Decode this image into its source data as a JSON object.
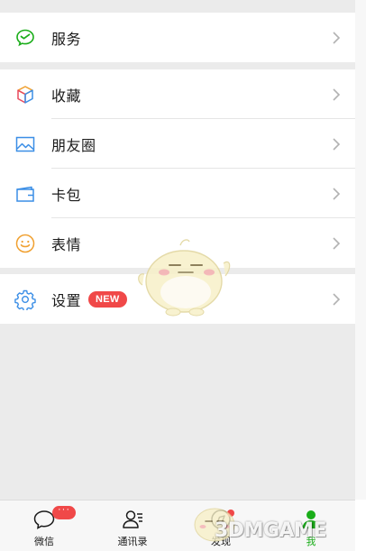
{
  "menu": {
    "services": {
      "label": "服务",
      "icon": "wechat-pay-icon"
    },
    "favorites": {
      "label": "收藏",
      "icon": "cube-icon"
    },
    "moments": {
      "label": "朋友圈",
      "icon": "photo-icon"
    },
    "cards": {
      "label": "卡包",
      "icon": "card-wallet-icon"
    },
    "stickers": {
      "label": "表情",
      "icon": "smiley-icon"
    },
    "settings": {
      "label": "设置",
      "icon": "gear-icon",
      "badge": "NEW"
    }
  },
  "tabbar": {
    "tabs": [
      {
        "label": "微信",
        "icon": "chat-bubble-icon",
        "badge": "···"
      },
      {
        "label": "通讯录",
        "icon": "contacts-icon"
      },
      {
        "label": "发现",
        "icon": "compass-icon"
      },
      {
        "label": "我",
        "icon": "person-icon",
        "active": true
      }
    ]
  },
  "watermark": {
    "text": "3DMGAME"
  },
  "colors": {
    "accent": "#1aad19",
    "badge": "#f04848",
    "background": "#ebebeb"
  }
}
